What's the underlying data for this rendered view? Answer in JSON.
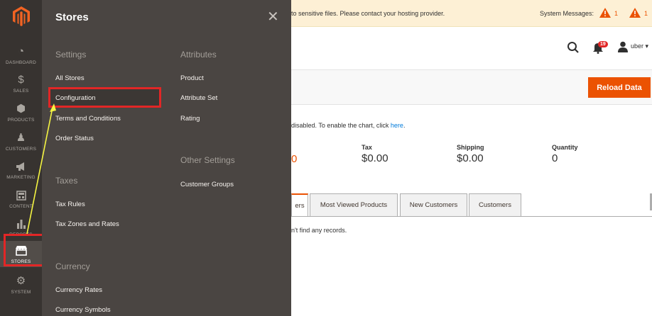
{
  "sidebar": {
    "items": [
      {
        "label": "DASHBOARD",
        "icon": "dashboard-icon",
        "glyph": "◔"
      },
      {
        "label": "SALES",
        "icon": "dollar-icon",
        "glyph": "$"
      },
      {
        "label": "PRODUCTS",
        "icon": "cube-icon",
        "glyph": "⬢"
      },
      {
        "label": "CUSTOMERS",
        "icon": "person-icon",
        "glyph": "♟"
      },
      {
        "label": "MARKETING",
        "icon": "megaphone-icon",
        "glyph": "📢"
      },
      {
        "label": "CONTENT",
        "icon": "layout-icon",
        "glyph": "▦"
      },
      {
        "label": "REPORTS",
        "icon": "bar-chart-icon",
        "glyph": "▮"
      },
      {
        "label": "STORES",
        "icon": "storefront-icon",
        "glyph": "⌂"
      },
      {
        "label": "SYSTEM",
        "icon": "gear-icon",
        "glyph": "⚙"
      }
    ]
  },
  "flyout": {
    "title": "Stores",
    "close_glyph": "✕",
    "settings": {
      "heading": "Settings",
      "links": [
        "All Stores",
        "Configuration",
        "Terms and Conditions",
        "Order Status"
      ]
    },
    "taxes": {
      "heading": "Taxes",
      "links": [
        "Tax Rules",
        "Tax Zones and Rates"
      ]
    },
    "currency": {
      "heading": "Currency",
      "links": [
        "Currency Rates",
        "Currency Symbols"
      ]
    },
    "attributes": {
      "heading": "Attributes",
      "links": [
        "Product",
        "Attribute Set",
        "Rating"
      ]
    },
    "other": {
      "heading": "Other Settings",
      "links": [
        "Customer Groups"
      ]
    }
  },
  "notice": {
    "text": "to sensitive files. Please contact your hosting provider.",
    "system_messages_label": "System Messages:",
    "warning_count_1": "1",
    "warning_count_2": "1"
  },
  "header": {
    "notification_count": "19",
    "user_name": "uber ▾"
  },
  "actions": {
    "reload_label": "Reload Data"
  },
  "chart_note": {
    "text": "disabled. To enable the chart, click ",
    "link": "here",
    "suffix": "."
  },
  "stats": {
    "cut_value": "0",
    "tax": {
      "label": "Tax",
      "value": "$0.00"
    },
    "shipping": {
      "label": "Shipping",
      "value": "$0.00"
    },
    "quantity": {
      "label": "Quantity",
      "value": "0"
    }
  },
  "tabs": [
    "ers",
    "Most Viewed Products",
    "New Customers",
    "Customers"
  ],
  "empty_message": "n't find any records.",
  "colors": {
    "accent": "#eb5202",
    "highlight": "#e22626",
    "arrow": "#f5f542"
  }
}
